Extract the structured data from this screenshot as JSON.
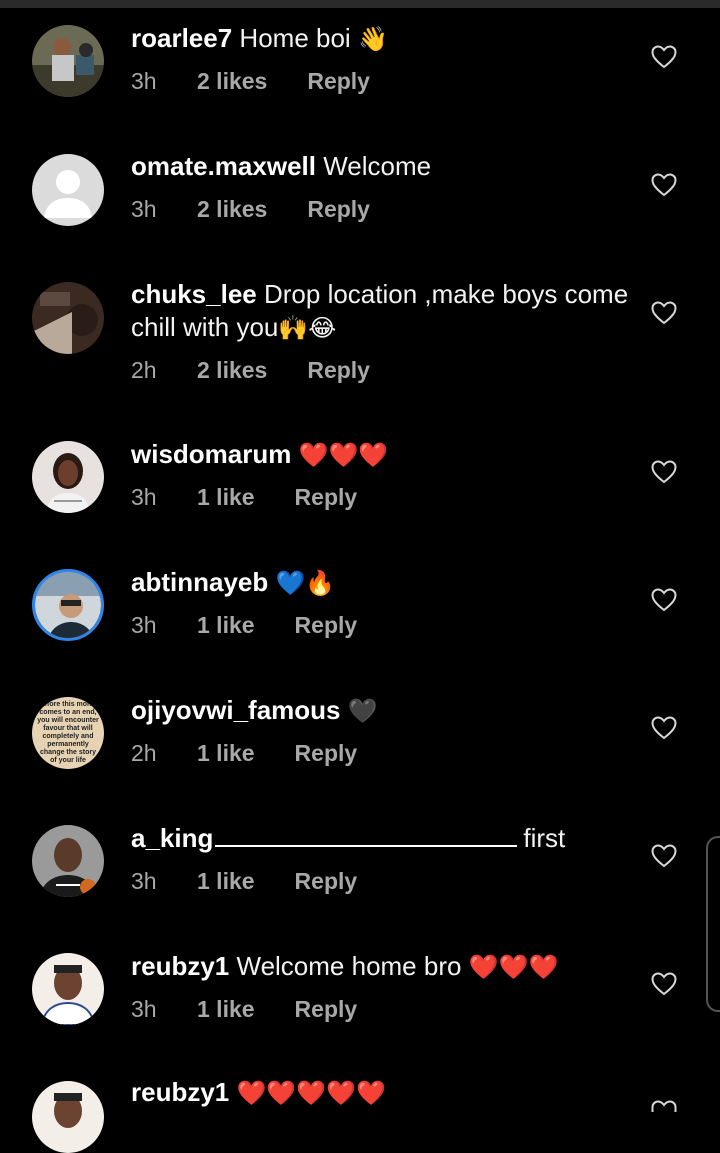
{
  "comments": [
    {
      "username": "roarlee7",
      "text": "Home boi",
      "emoji": "👋",
      "time": "3h",
      "likes": "2 likes",
      "reply": "Reply"
    },
    {
      "username": "omate.maxwell",
      "text": "Welcome",
      "emoji": "",
      "time": "3h",
      "likes": "2 likes",
      "reply": "Reply"
    },
    {
      "username": "chuks_lee",
      "text": "Drop location ,make boys come chill with you",
      "emoji": "🙌😂",
      "time": "2h",
      "likes": "2 likes",
      "reply": "Reply"
    },
    {
      "username": "wisdomarum",
      "text": "",
      "emoji": "❤️❤️❤️",
      "time": "3h",
      "likes": "1 like",
      "reply": "Reply"
    },
    {
      "username": "abtinnayeb",
      "text": "",
      "emoji": "💙🔥",
      "time": "3h",
      "likes": "1 like",
      "reply": "Reply"
    },
    {
      "username": "ojiyovwi_famous",
      "text": "",
      "emoji": "🖤",
      "time": "2h",
      "likes": "1 like",
      "reply": "Reply"
    },
    {
      "username": "a_king",
      "text": "first",
      "emoji": "",
      "time": "3h",
      "likes": "1 like",
      "reply": "Reply"
    },
    {
      "username": "reubzy1",
      "text": "Welcome home bro",
      "emoji": "❤️❤️❤️",
      "time": "3h",
      "likes": "1 like",
      "reply": "Reply"
    },
    {
      "username": "reubzy1",
      "text": "",
      "emoji": "❤️❤️❤️❤️❤️",
      "time": "",
      "likes": "",
      "reply": ""
    }
  ],
  "avatar_quote": "Before this month comes to an end, you will encounter favour that will completely and permanently change the story of your life",
  "icons": {
    "like": "heart-outline-icon"
  },
  "colors": {
    "background": "#000000",
    "meta_text": "#a8a8a8",
    "text": "#ffffff",
    "heart_red": "#e0102a",
    "heart_blue": "#2f86e8"
  }
}
